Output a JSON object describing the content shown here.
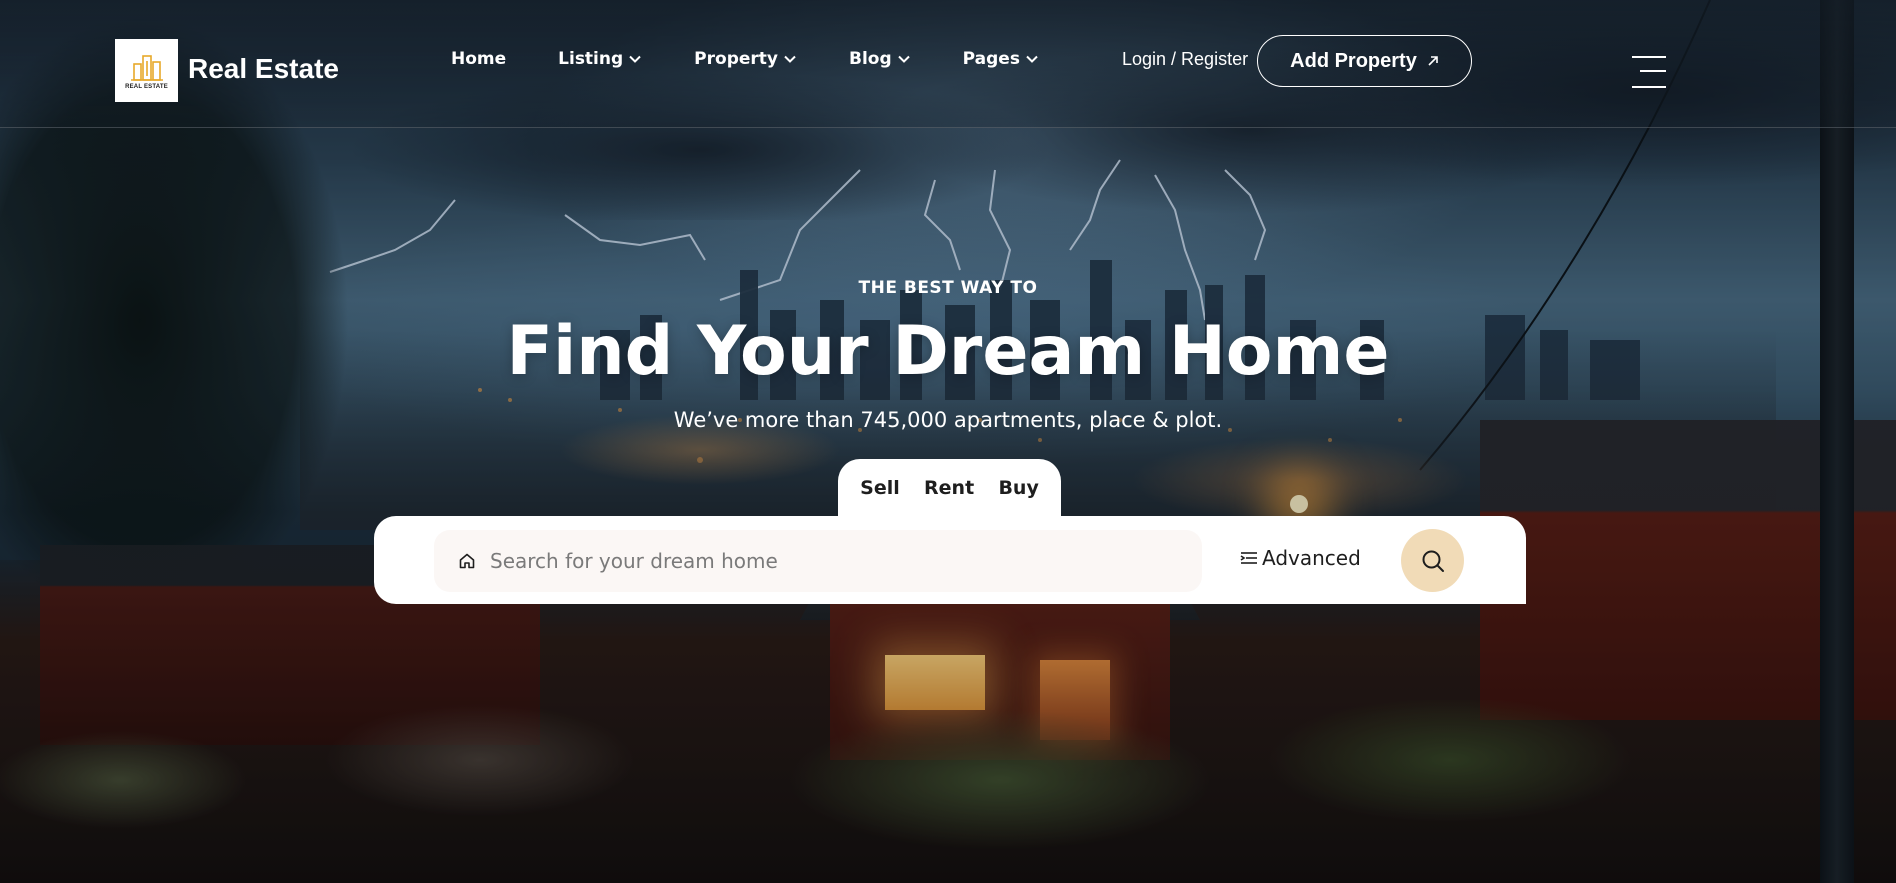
{
  "brand": {
    "name": "Real Estate",
    "logo_text": "REAL ESTATE",
    "logo_accent": "#e8a92a"
  },
  "nav": {
    "items": [
      {
        "label": "Home",
        "has_dropdown": false
      },
      {
        "label": "Listing",
        "has_dropdown": true
      },
      {
        "label": "Property",
        "has_dropdown": true
      },
      {
        "label": "Blog",
        "has_dropdown": true
      },
      {
        "label": "Pages",
        "has_dropdown": true
      }
    ],
    "login_label": "Login / Register",
    "cta_label": "Add Property",
    "cta_icon": "arrow-up-right-icon",
    "menu_icon": "hamburger-menu-icon"
  },
  "hero": {
    "eyebrow": "THE BEST WAY TO",
    "title": "Find Your Dream Home",
    "subtitle": "We’ve more than 745,000 apartments, place & plot."
  },
  "search": {
    "tabs": [
      "Sell",
      "Rent",
      "Buy"
    ],
    "placeholder": "Search for your dream home",
    "field_icon": "home-icon",
    "advanced_label": "Advanced",
    "advanced_icon": "filter-lines-icon",
    "button_icon": "search-icon",
    "button_color": "#f1dbb7"
  }
}
